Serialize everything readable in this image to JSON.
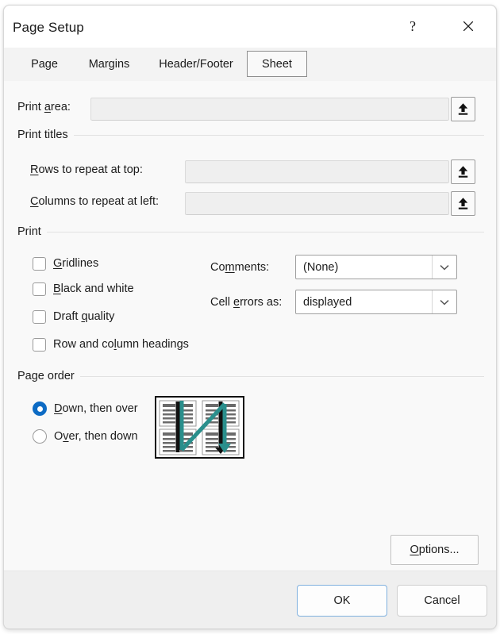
{
  "window": {
    "title": "Page Setup",
    "help_button": "?",
    "close_button": "✕"
  },
  "tabs": [
    {
      "label": "Page",
      "selected": false
    },
    {
      "label": "Margins",
      "selected": false
    },
    {
      "label": "Header/Footer",
      "selected": false
    },
    {
      "label": "Sheet",
      "selected": true
    }
  ],
  "print_area": {
    "label_pre": "Print ",
    "label_acc": "a",
    "label_post": "rea:",
    "value": "",
    "collapse_button_icon": "collapse-dialog-up-arrow-icon"
  },
  "print_titles": {
    "group_label": "Print titles",
    "rows": {
      "label_pre": "",
      "label_acc": "R",
      "label_post": "ows to repeat at top:",
      "value": "",
      "collapse_button_icon": "collapse-dialog-up-arrow-icon"
    },
    "columns": {
      "label_pre": "",
      "label_acc": "C",
      "label_post": "olumns to repeat at left:",
      "value": "",
      "collapse_button_icon": "collapse-dialog-up-arrow-icon"
    }
  },
  "print": {
    "group_label": "Print",
    "checkboxes": [
      {
        "pre": "",
        "acc": "G",
        "post": "ridlines",
        "checked": false
      },
      {
        "pre": "",
        "acc": "B",
        "post": "lack and white",
        "checked": false
      },
      {
        "pre": "Draft ",
        "acc": "q",
        "post": "uality",
        "checked": false
      },
      {
        "pre": "Row and co",
        "acc": "l",
        "post": "umn headings",
        "checked": false
      }
    ],
    "comments": {
      "label_pre": "Co",
      "label_acc": "m",
      "label_post": "ments:",
      "value": "(None)"
    },
    "cell_errors": {
      "label_pre": "Cell ",
      "label_acc": "e",
      "label_post": "rrors as:",
      "value": "displayed"
    }
  },
  "page_order": {
    "group_label": "Page order",
    "options": [
      {
        "pre": "",
        "acc": "D",
        "post": "own, then over",
        "selected": true
      },
      {
        "pre": "O",
        "acc": "v",
        "post": "er, then down",
        "selected": false
      }
    ],
    "preview_icon": "page-order-down-then-over-preview",
    "preview_accent_color": "#2a8f8c"
  },
  "buttons": {
    "options": {
      "pre": "",
      "acc": "O",
      "post": "ptions..."
    },
    "ok": "OK",
    "cancel": "Cancel"
  },
  "colors": {
    "accent_blue": "#0d6bc4",
    "default_button_border": "#7fb0de",
    "preview_teal": "#2a8f8c",
    "dialog_background": "#f9f9f9",
    "footer_background": "#efefef"
  }
}
